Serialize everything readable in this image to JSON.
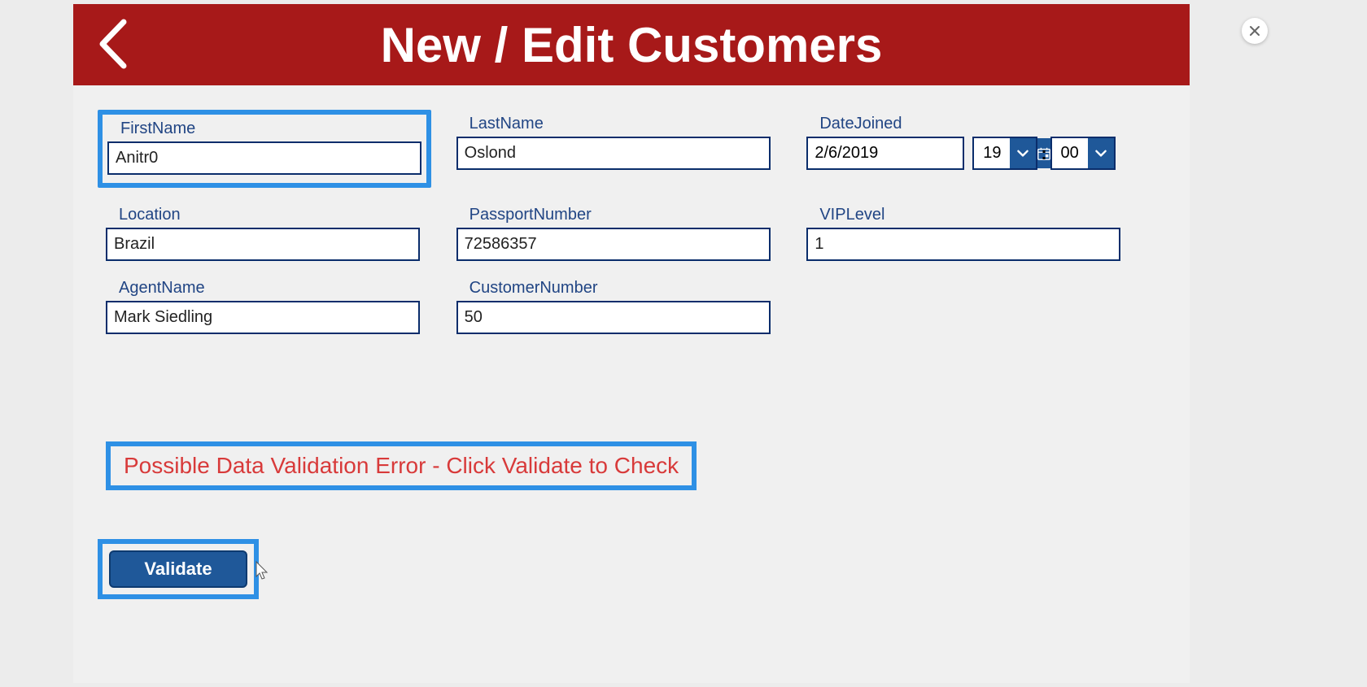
{
  "header": {
    "title": "New / Edit Customers"
  },
  "fields": {
    "firstName": {
      "label": "FirstName",
      "value": "Anitr0"
    },
    "lastName": {
      "label": "LastName",
      "value": "Oslond"
    },
    "dateJoined": {
      "label": "DateJoined",
      "date": "2/6/2019",
      "hour": "19",
      "minute": "00"
    },
    "location": {
      "label": "Location",
      "value": "Brazil"
    },
    "passportNumber": {
      "label": "PassportNumber",
      "value": "72586357"
    },
    "vipLevel": {
      "label": "VIPLevel",
      "value": "1"
    },
    "agentName": {
      "label": "AgentName",
      "value": "Mark Siedling"
    },
    "customerNumber": {
      "label": "CustomerNumber",
      "value": "50"
    }
  },
  "status": {
    "validationWarning": "Possible Data Validation Error - Click Validate to Check"
  },
  "buttons": {
    "validate": "Validate"
  },
  "meta": {
    "timeSeparator": ":"
  }
}
